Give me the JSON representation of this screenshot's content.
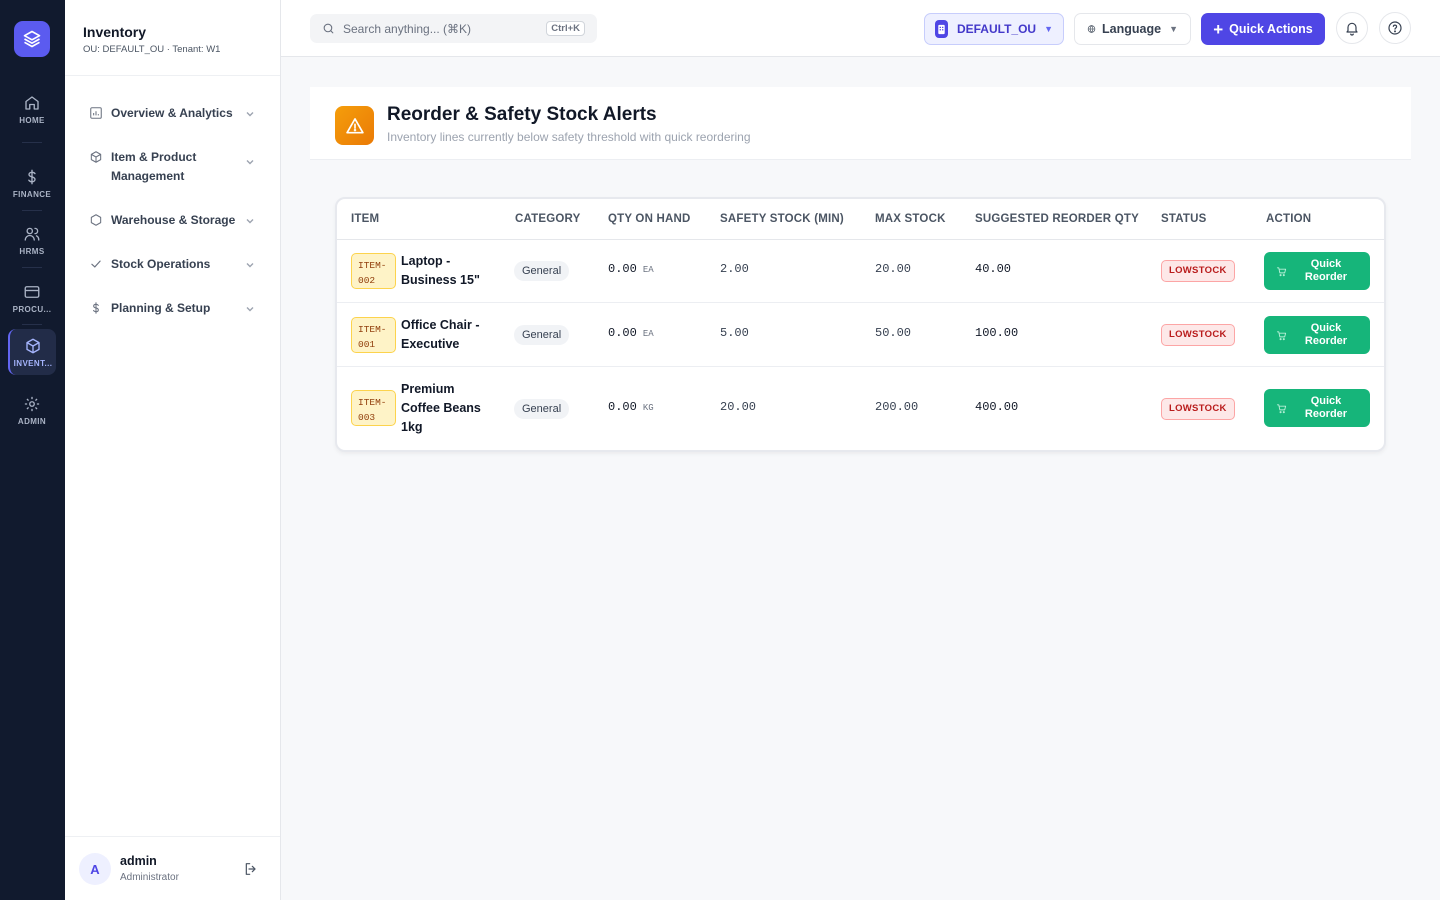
{
  "rail": {
    "items": [
      {
        "label": "HOME"
      },
      {
        "label": "FINANCE"
      },
      {
        "label": "HRMS"
      },
      {
        "label": "PROCU..."
      },
      {
        "label": "INVENT..."
      },
      {
        "label": "ADMIN"
      }
    ],
    "active_index": 4
  },
  "sidebar": {
    "title": "Inventory",
    "subtitle": "OU: DEFAULT_OU · Tenant: W1",
    "nav": [
      {
        "label": "Overview & Analytics",
        "icon": "chart-icon"
      },
      {
        "label": "Item & Product Management",
        "icon": "box-icon"
      },
      {
        "label": "Warehouse & Storage",
        "icon": "hexagon-icon"
      },
      {
        "label": "Stock Operations",
        "icon": "check-icon"
      },
      {
        "label": "Planning & Setup",
        "icon": "dollar-icon"
      }
    ],
    "user": {
      "initial": "A",
      "name": "admin",
      "role": "Administrator"
    }
  },
  "topbar": {
    "search_placeholder": "Search anything... (⌘K)",
    "search_shortcut": "Ctrl+K",
    "ou_label": "DEFAULT_OU",
    "language_label": "Language",
    "quick_actions_label": "Quick Actions"
  },
  "page": {
    "title": "Reorder & Safety Stock Alerts",
    "subtitle": "Inventory lines currently below safety threshold with quick reordering"
  },
  "table": {
    "columns": [
      "ITEM",
      "CATEGORY",
      "QTY ON HAND",
      "SAFETY STOCK (MIN)",
      "MAX STOCK",
      "SUGGESTED REORDER QTY",
      "STATUS",
      "ACTION"
    ],
    "rows": [
      {
        "sku_line1": "ITEM-",
        "sku_line2": "002",
        "name": "Laptop - Business 15\"",
        "category": "General",
        "qty": "0.00",
        "unit": "EA",
        "safety": "2.00",
        "max": "20.00",
        "reorder": "40.00",
        "status": "LOWSTOCK",
        "action": "Quick Reorder"
      },
      {
        "sku_line1": "ITEM-",
        "sku_line2": "001",
        "name": "Office Chair - Executive",
        "category": "General",
        "qty": "0.00",
        "unit": "EA",
        "safety": "5.00",
        "max": "50.00",
        "reorder": "100.00",
        "status": "LOWSTOCK",
        "action": "Quick Reorder"
      },
      {
        "sku_line1": "ITEM-",
        "sku_line2": "003",
        "name": "Premium Coffee Beans 1kg",
        "category": "General",
        "qty": "0.00",
        "unit": "KG",
        "safety": "20.00",
        "max": "200.00",
        "reorder": "400.00",
        "status": "LOWSTOCK",
        "action": "Quick Reorder"
      }
    ]
  },
  "colors": {
    "rail_bg": "#111a2e",
    "brand": "#4f46e5",
    "warning": "#f59e0b",
    "success": "#16b57a",
    "danger": "#b91c1c"
  }
}
